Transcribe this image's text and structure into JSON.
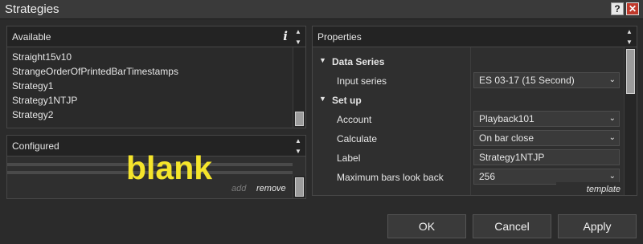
{
  "window": {
    "title": "Strategies",
    "help_label": "?",
    "close_label": "✕"
  },
  "available": {
    "header": "Available",
    "info_label": "i",
    "items": [
      "Straight15v10",
      "StrangeOrderOfPrintedBarTimestamps",
      "Strategy1",
      "Strategy1NTJP",
      "Strategy2"
    ]
  },
  "configured": {
    "header": "Configured",
    "add_label": "add",
    "remove_label": "remove"
  },
  "overlay_text": "blank",
  "properties": {
    "header": "Properties",
    "sections": [
      {
        "label": "Data Series",
        "rows": [
          {
            "label": "Input series",
            "value": "ES 03-17 (15 Second)"
          }
        ]
      },
      {
        "label": "Set up",
        "rows": [
          {
            "label": "Account",
            "value": "Playback101"
          },
          {
            "label": "Calculate",
            "value": "On bar close"
          },
          {
            "label": "Label",
            "value": "Strategy1NTJP"
          },
          {
            "label": "Maximum bars look back",
            "value": "256"
          }
        ]
      }
    ],
    "template_label": "template"
  },
  "buttons": {
    "ok": "OK",
    "cancel": "Cancel",
    "apply": "Apply"
  },
  "colors": {
    "overlay": "#f5e52b",
    "close": "#c0392b",
    "background": "#2b2b2b"
  }
}
